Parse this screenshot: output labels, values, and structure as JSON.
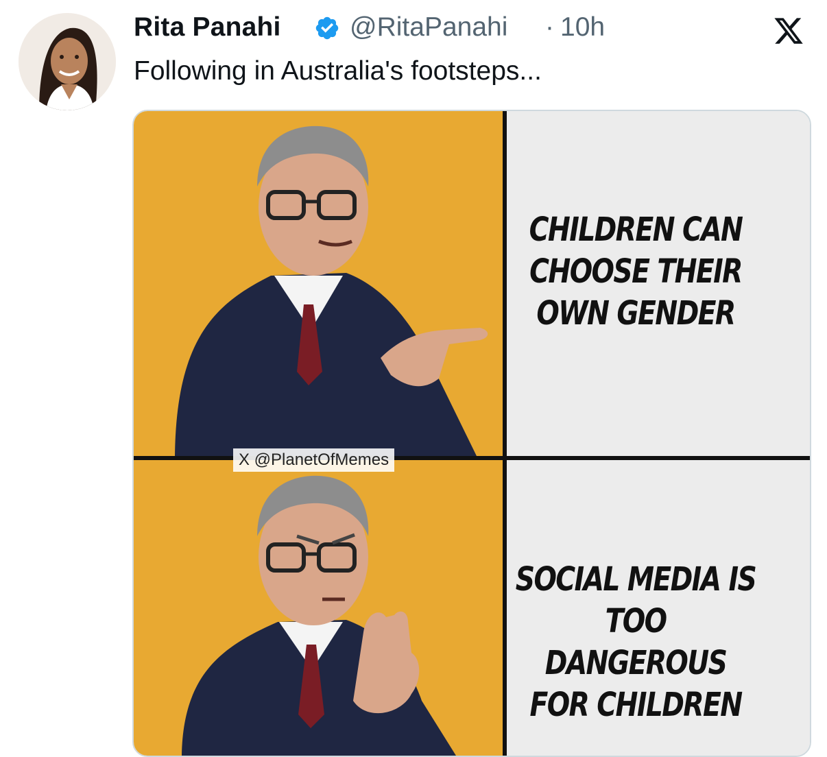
{
  "tweet": {
    "author_name": "Rita Panahi",
    "handle": "@RitaPanahi",
    "separator": "·",
    "time": "10h",
    "text": "Following in Australia's footsteps..."
  },
  "icons": {
    "verified": "verified-badge-icon",
    "platform": "x-logo-icon"
  },
  "meme": {
    "watermark": "X @PlanetOfMemes",
    "top_panel_text": "CHILDREN CAN\nCHOOSE THEIR\nOWN GENDER",
    "bottom_panel_text": "SOCIAL MEDIA IS\nTOO DANGEROUS\nFOR CHILDREN"
  },
  "colors": {
    "accent_blue": "#1d9bf0",
    "meme_background": "#e8a932",
    "text_secondary": "#536471"
  }
}
